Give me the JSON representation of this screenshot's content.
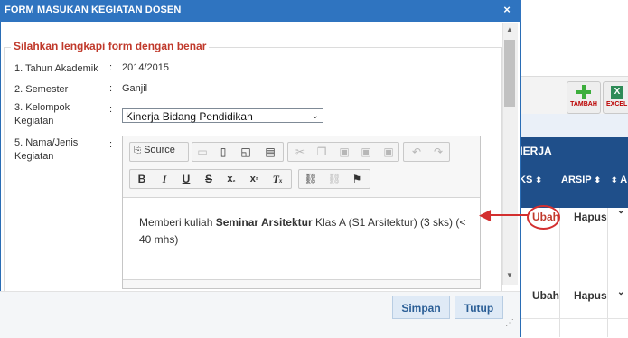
{
  "dialog": {
    "title": "FORM MASUKAN KEGIATAN DOSEN",
    "close_glyph": "×",
    "legend": "Silahkan lengkapi form dengan benar"
  },
  "form": {
    "rows": [
      {
        "label": "1. Tahun Akademik",
        "value": "2014/2015"
      },
      {
        "label": "2. Semester",
        "value": "Ganjil"
      },
      {
        "label": "3. Kelompok Kegiatan",
        "label_line1": "3. Kelompok",
        "label_line2": "Kegiatan"
      },
      {
        "label": "5. Nama/Jenis Kegiatan",
        "label_line1": "5. Nama/Jenis",
        "label_line2": "Kegiatan"
      }
    ],
    "colon": ":",
    "kelompok_selected": "Kinerja Bidang Pendidikan"
  },
  "editor": {
    "source_label": "Source",
    "content_pre": "Memberi kuliah ",
    "content_bold": "Seminar Arsitektur",
    "content_post": " Klas A (S1 Arsitektur) (3 sks) (< 40 mhs)"
  },
  "buttons": {
    "save": "Simpan",
    "close": "Tutup"
  },
  "background": {
    "tambah": "TAMBAH",
    "excel": "EXCEL",
    "section": "NERJA",
    "col_sks": "KS",
    "col_arsip": "ARSIP",
    "col_a": "A",
    "rows": [
      {
        "ubah": "Ubah",
        "hapus": "Hapus"
      },
      {
        "ubah": "Ubah",
        "hapus": "Hapus"
      }
    ]
  }
}
